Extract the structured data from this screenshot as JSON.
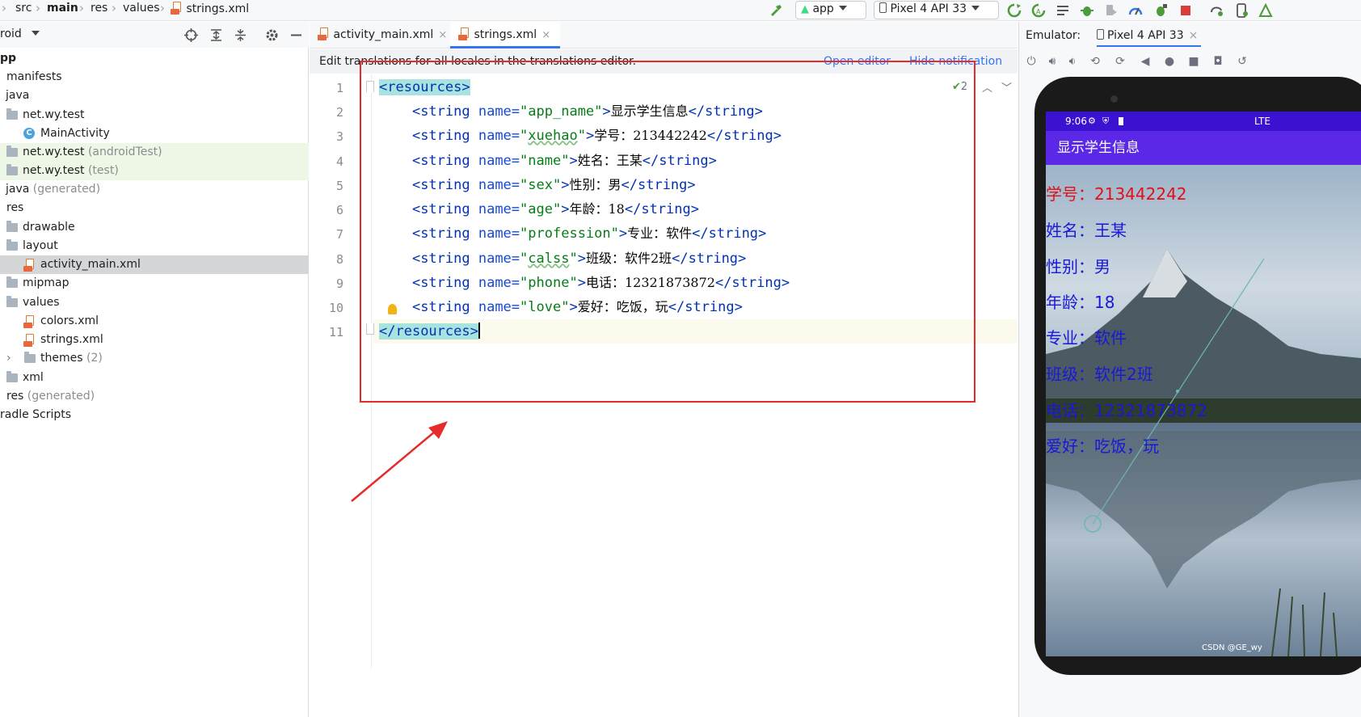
{
  "breadcrumb": {
    "items": [
      "src",
      "main",
      "res",
      "values"
    ],
    "file": "strings.xml"
  },
  "run_toolbar": {
    "config_label": "app",
    "device_label": "Pixel 4 API 33"
  },
  "sidebar": {
    "header_label": "roid",
    "tree": [
      {
        "label": "pp",
        "suffix": ""
      },
      {
        "label": "manifests",
        "suffix": ""
      },
      {
        "label": "java",
        "suffix": ""
      },
      {
        "label": "net.wy.test",
        "suffix": ""
      },
      {
        "label": "MainActivity",
        "suffix": ""
      },
      {
        "label": "net.wy.test",
        "suffix": " (androidTest)"
      },
      {
        "label": "net.wy.test",
        "suffix": " (test)"
      },
      {
        "label": "java",
        "suffix": " (generated)"
      },
      {
        "label": "res",
        "suffix": ""
      },
      {
        "label": "drawable",
        "suffix": ""
      },
      {
        "label": "layout",
        "suffix": ""
      },
      {
        "label": "activity_main.xml",
        "suffix": ""
      },
      {
        "label": "mipmap",
        "suffix": ""
      },
      {
        "label": "values",
        "suffix": ""
      },
      {
        "label": "colors.xml",
        "suffix": ""
      },
      {
        "label": "strings.xml",
        "suffix": ""
      },
      {
        "label": "themes",
        "suffix": " (2)"
      },
      {
        "label": "xml",
        "suffix": ""
      },
      {
        "label": "res",
        "suffix": " (generated)"
      },
      {
        "label": "radle Scripts",
        "suffix": ""
      }
    ]
  },
  "editor": {
    "tabs": [
      {
        "label": "activity_main.xml"
      },
      {
        "label": "strings.xml"
      }
    ],
    "notification": {
      "text": "Edit translations for all locales in the translations editor.",
      "open_editor": "Open editor",
      "hide": "Hide notification"
    },
    "inspection_count": "2",
    "line_numbers": [
      "1",
      "2",
      "3",
      "4",
      "5",
      "6",
      "7",
      "8",
      "9",
      "10",
      "11"
    ],
    "code": {
      "open_tag": "resources",
      "close_tag": "resources",
      "strings": [
        {
          "name": "app_name",
          "value": "显示学生信息"
        },
        {
          "name": "xuehao",
          "value": "学号：213442242"
        },
        {
          "name": "name",
          "value": "姓名：王某"
        },
        {
          "name": "sex",
          "value": "性别：男"
        },
        {
          "name": "age",
          "value": "年龄：18"
        },
        {
          "name": "profession",
          "value": "专业：软件"
        },
        {
          "name": "calss",
          "value": "班级：软件2班"
        },
        {
          "name": "phone",
          "value": "电话：12321873872"
        },
        {
          "name": "love",
          "value": "爱好：吃饭，玩"
        }
      ]
    }
  },
  "emulator": {
    "label": "Emulator:",
    "device_tab": "Pixel 4 API 33",
    "status_time": "9:06",
    "status_network": "LTE",
    "app_title": "显示学生信息",
    "lines": [
      "学号：213442242",
      "姓名：王某",
      "性别：男",
      "年龄：18",
      "专业：软件",
      "班级：软件2班",
      "电话：12321873872",
      "爱好：吃饭，玩"
    ],
    "watermark": "CSDN @GE_wy"
  },
  "colors": {
    "accent": "#3574f0",
    "annotation": "#e52b2b",
    "app_bar": "#5a28e6",
    "status_bar": "#3b12cf"
  }
}
